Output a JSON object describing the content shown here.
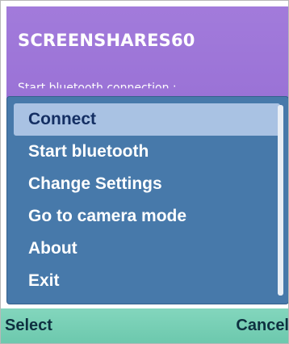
{
  "app": {
    "title": "SCREENSHARES60",
    "subtitle": "Start bluetooth connection :"
  },
  "menu": {
    "items": [
      {
        "label": "Connect",
        "selected": true
      },
      {
        "label": "Start bluetooth",
        "selected": false
      },
      {
        "label": "Change Settings",
        "selected": false
      },
      {
        "label": "Go to camera mode",
        "selected": false
      },
      {
        "label": "About",
        "selected": false
      },
      {
        "label": "Exit",
        "selected": false
      }
    ]
  },
  "softkeys": {
    "left_label": "Select",
    "right_label": "Cancel"
  },
  "colors": {
    "title_bar": "#a27bdb",
    "menu_background": "#4779aa",
    "menu_highlight": "#a9c2e3",
    "softkey_bar": "#7bd2b8"
  }
}
